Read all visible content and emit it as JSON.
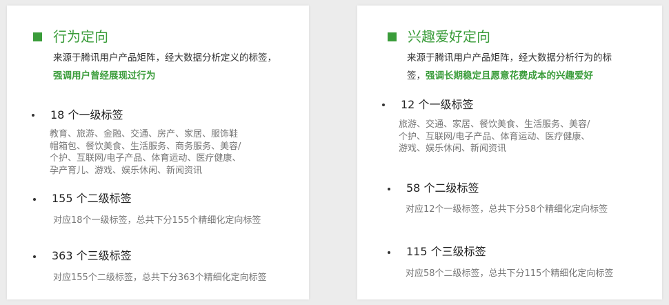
{
  "colors": {
    "accent": "#3a9c3a",
    "card": "#ffffff",
    "background": "#ececec"
  },
  "left": {
    "title": "行为定向",
    "desc_line1": "来源于腾讯用户产品矩阵，经大数据分析定义的标签，",
    "desc_emph": "强调用户曾经展现过行为",
    "items": [
      {
        "label": "18 个一级标签",
        "sub": [
          "教育、旅游、金融、交通、房产、家居、服饰鞋",
          "帽箱包、餐饮美食、生活服务、商务服务、美容/",
          "个护、互联网/电子产品、体育运动、医疗健康、",
          "孕产育儿、游戏、娱乐休闲、新闻资讯"
        ]
      },
      {
        "label": "155 个二级标签",
        "sub": [
          "对应18个一级标签，总共下分155个精细化定向标签"
        ]
      },
      {
        "label": "363 个三级标签",
        "sub": [
          "对应155个二级标签，总共下分363个精细化定向标签"
        ]
      }
    ]
  },
  "right": {
    "title": "兴趣爱好定向",
    "desc_line1": "来源于腾讯用户产品矩阵，经大数据分析行为的标",
    "desc_line2_prefix": "签，",
    "desc_emph": "强调长期稳定且愿意花费成本的兴趣爱好",
    "items": [
      {
        "label": "12 个一级标签",
        "sub": [
          "旅游、交通、家居、餐饮美食、生活服务、美容/",
          "个护、互联网/电子产品、体育运动、医疗健康、",
          "游戏、娱乐休闲、新闻资讯"
        ]
      },
      {
        "label": "58 个二级标签",
        "sub": [
          "对应12个一级标签，总共下分58个精细化定向标签"
        ]
      },
      {
        "label": "115 个三级标签",
        "sub": [
          "对应58个二级标签，总共下分115个精细化定向标签"
        ]
      }
    ]
  }
}
